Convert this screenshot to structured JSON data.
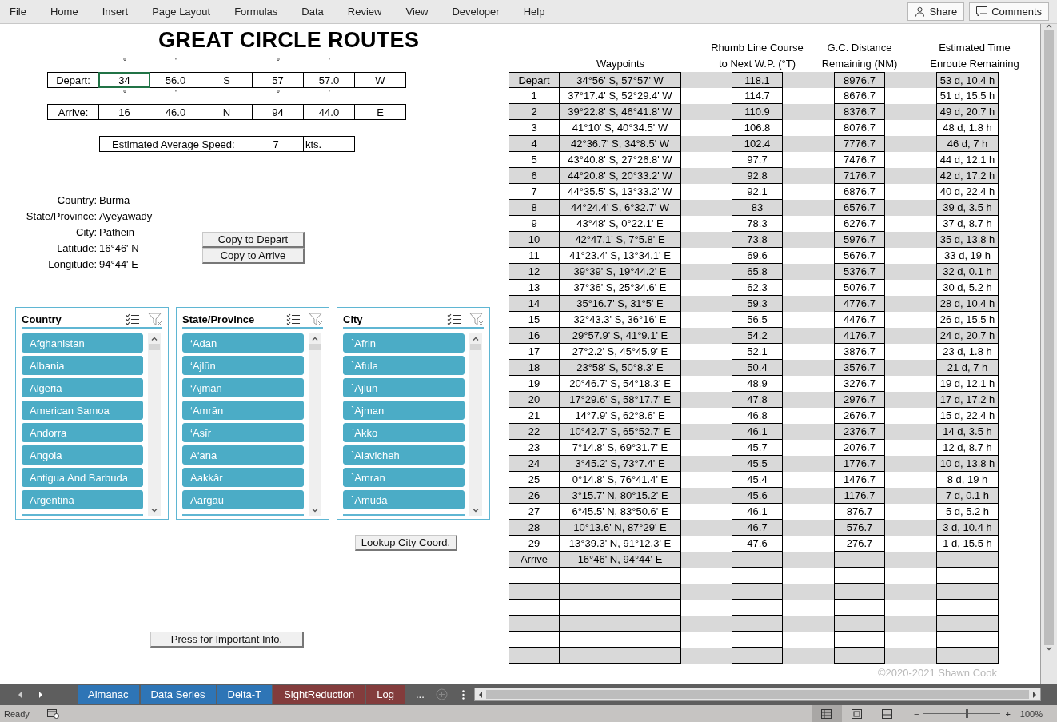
{
  "menu": {
    "tabs": [
      "File",
      "Home",
      "Insert",
      "Page Layout",
      "Formulas",
      "Data",
      "Review",
      "View",
      "Developer",
      "Help"
    ],
    "buttons": [
      {
        "label": "Share",
        "kind": "share"
      },
      {
        "label": "Comments",
        "kind": "comments"
      }
    ]
  },
  "title": "GREAT CIRCLE ROUTES",
  "coordinates": [
    {
      "label": "Depart:",
      "cells": [
        {
          "value": "34",
          "mark": "°",
          "selected": true
        },
        {
          "value": "56.0",
          "mark": "'",
          "selected": false
        },
        {
          "value": "S",
          "selected": false
        },
        {
          "value": "57",
          "mark": "°",
          "selected": false
        },
        {
          "value": "57.0",
          "mark": "'",
          "selected": false
        },
        {
          "value": "W",
          "selected": false
        }
      ]
    },
    {
      "label": "Arrive:",
      "cells": [
        {
          "value": "16",
          "mark": "°",
          "selected": false
        },
        {
          "value": "46.0",
          "mark": "'",
          "selected": false
        },
        {
          "value": "N",
          "selected": false
        },
        {
          "value": "94",
          "mark": "°",
          "selected": false
        },
        {
          "value": "44.0",
          "mark": "'",
          "selected": false
        },
        {
          "value": "E",
          "selected": false
        }
      ]
    }
  ],
  "speed": {
    "label": "Estimated Average Speed:",
    "value": "7",
    "unit": "kts."
  },
  "location": [
    {
      "label": "Country:",
      "value": "Burma"
    },
    {
      "label": "State/Province:",
      "value": "Ayeyawady"
    },
    {
      "label": "City:",
      "value": "Pathein"
    },
    {
      "label": "Latitude:",
      "value": "16°46' N"
    },
    {
      "label": "Longitude:",
      "value": "94°44' E"
    }
  ],
  "copy_buttons": [
    "Copy to Depart",
    "Copy to Arrive"
  ],
  "slicers": [
    {
      "title": "Country",
      "items": [
        {
          "label": "Afghanistan",
          "selected": true
        },
        {
          "label": "Albania",
          "selected": true
        },
        {
          "label": "Algeria",
          "selected": true
        },
        {
          "label": "American Samoa",
          "selected": true
        },
        {
          "label": "Andorra",
          "selected": true
        },
        {
          "label": "Angola",
          "selected": true
        },
        {
          "label": "Antigua And Barbuda",
          "selected": true
        },
        {
          "label": "Argentina",
          "selected": true
        }
      ]
    },
    {
      "title": "State/Province",
      "items": [
        {
          "label": "‘Adan",
          "selected": true
        },
        {
          "label": "‘Ajlūn",
          "selected": true
        },
        {
          "label": "‘Ajmān",
          "selected": true
        },
        {
          "label": "‘Amrān",
          "selected": true
        },
        {
          "label": "‘Asīr",
          "selected": true
        },
        {
          "label": "A‘ana",
          "selected": true
        },
        {
          "label": "Aakkâr",
          "selected": true
        },
        {
          "label": "Aargau",
          "selected": true
        }
      ]
    },
    {
      "title": "City",
      "items": [
        {
          "label": "`Afrin",
          "selected": true
        },
        {
          "label": "`Afula",
          "selected": true
        },
        {
          "label": "`Ajlun",
          "selected": true
        },
        {
          "label": "`Ajman",
          "selected": true
        },
        {
          "label": "`Akko",
          "selected": true
        },
        {
          "label": "`Alavicheh",
          "selected": true
        },
        {
          "label": "`Amran",
          "selected": true
        },
        {
          "label": "`Amuda",
          "selected": true
        }
      ]
    }
  ],
  "lookup_button": "Lookup City Coord.",
  "info_button": "Press for Important Info.",
  "route_table": {
    "headers": [
      [
        "Waypoints"
      ],
      [
        "Rhumb Line Course",
        "to Next W.P. (°T)"
      ],
      [
        "G.C. Distance",
        "Remaining (NM)"
      ],
      [
        "Estimated Time",
        "Enroute Remaining"
      ]
    ],
    "rows": [
      [
        "Depart",
        "34°56' S, 57°57' W",
        "118.1",
        "8976.7",
        "53 d, 10.4 h"
      ],
      [
        "1",
        "37°17.4' S, 52°29.4' W",
        "114.7",
        "8676.7",
        "51 d, 15.5 h"
      ],
      [
        "2",
        "39°22.8' S, 46°41.8' W",
        "110.9",
        "8376.7",
        "49 d, 20.7 h"
      ],
      [
        "3",
        "41°10' S, 40°34.5' W",
        "106.8",
        "8076.7",
        "48 d, 1.8 h"
      ],
      [
        "4",
        "42°36.7' S, 34°8.5' W",
        "102.4",
        "7776.7",
        "46 d, 7 h"
      ],
      [
        "5",
        "43°40.8' S, 27°26.8' W",
        "97.7",
        "7476.7",
        "44 d, 12.1 h"
      ],
      [
        "6",
        "44°20.8' S, 20°33.2' W",
        "92.8",
        "7176.7",
        "42 d, 17.2 h"
      ],
      [
        "7",
        "44°35.5' S, 13°33.2' W",
        "92.1",
        "6876.7",
        "40 d, 22.4 h"
      ],
      [
        "8",
        "44°24.4' S, 6°32.7' W",
        "83",
        "6576.7",
        "39 d, 3.5 h"
      ],
      [
        "9",
        "43°48' S, 0°22.1' E",
        "78.3",
        "6276.7",
        "37 d, 8.7 h"
      ],
      [
        "10",
        "42°47.1' S, 7°5.8' E",
        "73.8",
        "5976.7",
        "35 d, 13.8 h"
      ],
      [
        "11",
        "41°23.4' S, 13°34.1' E",
        "69.6",
        "5676.7",
        "33 d, 19 h"
      ],
      [
        "12",
        "39°39' S, 19°44.2' E",
        "65.8",
        "5376.7",
        "32 d, 0.1 h"
      ],
      [
        "13",
        "37°36' S, 25°34.6' E",
        "62.3",
        "5076.7",
        "30 d, 5.2 h"
      ],
      [
        "14",
        "35°16.7' S, 31°5' E",
        "59.3",
        "4776.7",
        "28 d, 10.4 h"
      ],
      [
        "15",
        "32°43.3' S, 36°16' E",
        "56.5",
        "4476.7",
        "26 d, 15.5 h"
      ],
      [
        "16",
        "29°57.9' S, 41°9.1' E",
        "54.2",
        "4176.7",
        "24 d, 20.7 h"
      ],
      [
        "17",
        "27°2.2' S, 45°45.9' E",
        "52.1",
        "3876.7",
        "23 d, 1.8 h"
      ],
      [
        "18",
        "23°58' S, 50°8.3' E",
        "50.4",
        "3576.7",
        "21 d, 7 h"
      ],
      [
        "19",
        "20°46.7' S, 54°18.3' E",
        "48.9",
        "3276.7",
        "19 d, 12.1 h"
      ],
      [
        "20",
        "17°29.6' S, 58°17.7' E",
        "47.8",
        "2976.7",
        "17 d, 17.2 h"
      ],
      [
        "21",
        "14°7.9' S, 62°8.6' E",
        "46.8",
        "2676.7",
        "15 d, 22.4 h"
      ],
      [
        "22",
        "10°42.7' S, 65°52.7' E",
        "46.1",
        "2376.7",
        "14 d, 3.5 h"
      ],
      [
        "23",
        "7°14.8' S, 69°31.7' E",
        "45.7",
        "2076.7",
        "12 d, 8.7 h"
      ],
      [
        "24",
        "3°45.2' S, 73°7.4' E",
        "45.5",
        "1776.7",
        "10 d, 13.8 h"
      ],
      [
        "25",
        "0°14.8' S, 76°41.4' E",
        "45.4",
        "1476.7",
        "8 d, 19 h"
      ],
      [
        "26",
        "3°15.7' N, 80°15.2' E",
        "45.6",
        "1176.7",
        "7 d, 0.1 h"
      ],
      [
        "27",
        "6°45.5' N, 83°50.6' E",
        "46.1",
        "876.7",
        "5 d, 5.2 h"
      ],
      [
        "28",
        "10°13.6' N, 87°29' E",
        "46.7",
        "576.7",
        "3 d, 10.4 h"
      ],
      [
        "29",
        "13°39.3' N, 91°12.3' E",
        "47.6",
        "276.7",
        "1 d, 15.5 h"
      ],
      [
        "Arrive",
        "16°46' N, 94°44' E"
      ]
    ]
  },
  "copyright": "©2020-2021 Shawn Cook",
  "sheet_tabs": [
    {
      "label": "Almanac",
      "color": "#2e75b6"
    },
    {
      "label": "Data Series",
      "color": "#2e75b6"
    },
    {
      "label": "Delta-T",
      "color": "#2e75b6"
    },
    {
      "label": "SightReduction",
      "color": "#833c3c"
    },
    {
      "label": "Log",
      "color": "#833c3c"
    }
  ],
  "more_tabs": "...",
  "status_bar": {
    "status": "Ready",
    "views": [
      {
        "kind": "normal",
        "selected": true
      },
      {
        "kind": "layout",
        "selected": false
      },
      {
        "kind": "pagebreak",
        "selected": false
      }
    ],
    "zoom_out": "−",
    "zoom_in": "+",
    "zoom": {
      "level": 0.55
    },
    "zoom_text": "100%"
  }
}
